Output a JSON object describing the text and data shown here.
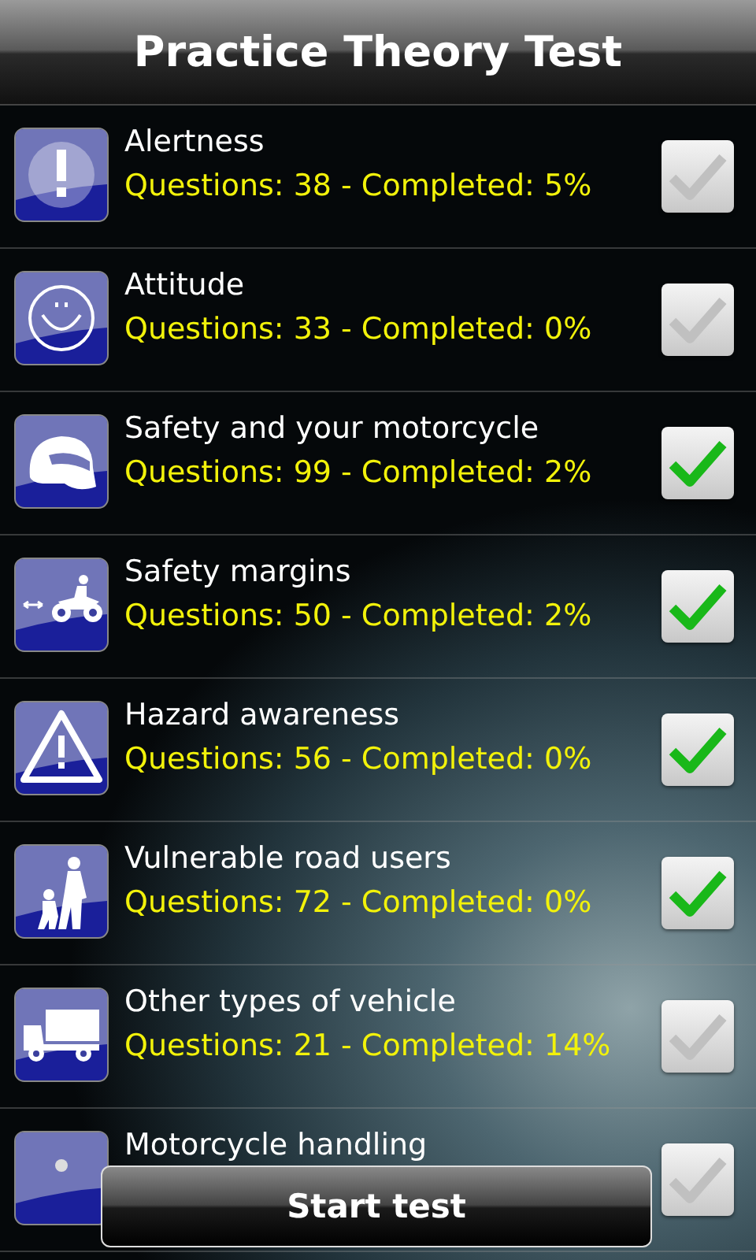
{
  "title": "Practice Theory Test",
  "categories": [
    {
      "kind": "exclamation",
      "name": "Alertness",
      "stats": "Questions: 38 - Completed: 5%",
      "checked": false
    },
    {
      "kind": "smiley",
      "name": "Attitude",
      "stats": "Questions: 33 - Completed: 0%",
      "checked": false
    },
    {
      "kind": "helmet",
      "name": "Safety and your motorcycle",
      "stats": "Questions: 99 - Completed: 2%",
      "checked": true
    },
    {
      "kind": "motorcycle",
      "name": "Safety margins",
      "stats": "Questions: 50 - Completed: 2%",
      "checked": true
    },
    {
      "kind": "warning",
      "name": "Hazard awareness",
      "stats": "Questions: 56 - Completed: 0%",
      "checked": true
    },
    {
      "kind": "pedestrians",
      "name": "Vulnerable road users",
      "stats": "Questions: 72 - Completed: 0%",
      "checked": true
    },
    {
      "kind": "truck",
      "name": "Other types of vehicle",
      "stats": "Questions: 21 - Completed: 14%",
      "checked": false
    },
    {
      "kind": "dot",
      "name": "Motorcycle handling",
      "checked": false
    }
  ],
  "button": "Start test"
}
